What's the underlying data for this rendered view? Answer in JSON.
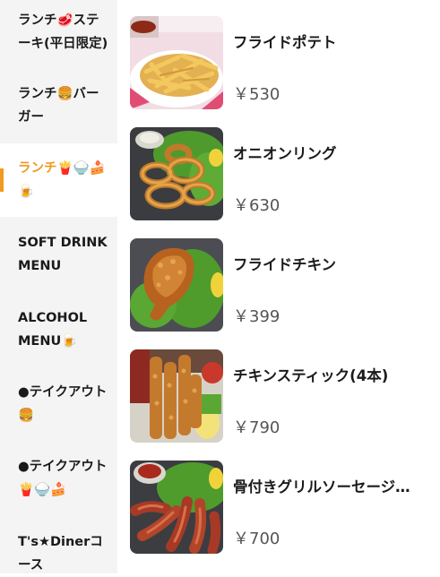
{
  "sidebar": {
    "categories": [
      {
        "line1": "ランチ🥩ステ",
        "line2": "ーキ(平日限定)"
      },
      {
        "line1": "ランチ🍔バー",
        "line2": "ガー"
      },
      {
        "line1": "ランチ🍟🍚🍰",
        "line2": "🍺"
      },
      {
        "line1": "SOFT DRINK",
        "line2": "MENU"
      },
      {
        "line1": "ALCOHOL",
        "line2": "MENU🍺"
      },
      {
        "line1": "●テイクアウト",
        "line2": "🍔"
      },
      {
        "line1": "●テイクアウト",
        "line2": "🍟🍚🍰"
      },
      {
        "line1": "T's★Dinerコ",
        "line2": "ース"
      }
    ],
    "active_index": 2,
    "active_color": "#f19a1f"
  },
  "menu": {
    "items": [
      {
        "name": "フライドポテト",
        "price": "￥530",
        "image": "french-fries-image"
      },
      {
        "name": "オニオンリング",
        "price": "￥630",
        "image": "onion-rings-image"
      },
      {
        "name": "フライドチキン",
        "price": "￥399",
        "image": "fried-chicken-image"
      },
      {
        "name": "チキンスティック(4本)",
        "price": "￥790",
        "image": "chicken-sticks-image"
      },
      {
        "name": "骨付きグリルソーセージ…",
        "price": "￥700",
        "image": "grilled-sausage-image"
      }
    ]
  }
}
